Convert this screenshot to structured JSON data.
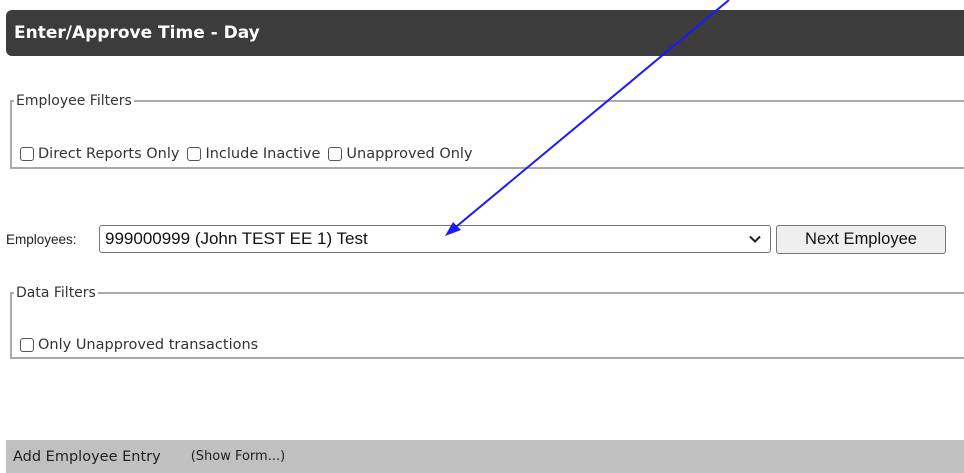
{
  "header": {
    "title": "Enter/Approve Time - Day"
  },
  "employee_filters": {
    "legend": "Employee Filters",
    "options": [
      {
        "label": "Direct Reports Only",
        "checked": false
      },
      {
        "label": "Include Inactive",
        "checked": false
      },
      {
        "label": "Unapproved Only",
        "checked": false
      }
    ]
  },
  "employee_select": {
    "label": "Employees:",
    "value": "999000999 (John TEST EE 1) Test",
    "next_button": "Next Employee"
  },
  "data_filters": {
    "legend": "Data Filters",
    "options": [
      {
        "label": "Only Unapproved transactions",
        "checked": false
      }
    ]
  },
  "add_entry": {
    "title": "Add Employee Entry",
    "toggle": "(Show Form...)"
  },
  "annotation": {
    "color": "#1a1aff"
  },
  "colors": {
    "title_bar": "#3c3c3c",
    "add_bar": "#c0c0c0"
  }
}
